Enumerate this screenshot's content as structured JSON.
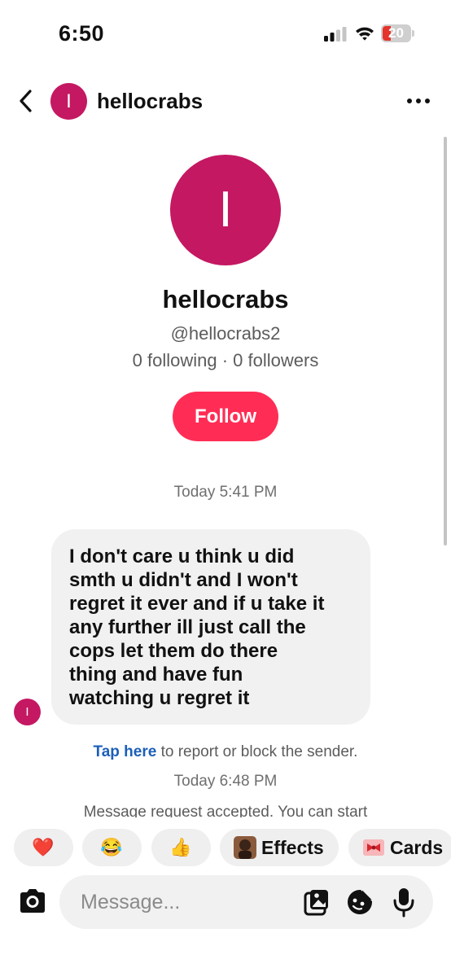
{
  "status_bar": {
    "time": "6:50",
    "battery": "20"
  },
  "header": {
    "avatar_initial": "I",
    "username": "hellocrabs"
  },
  "profile": {
    "avatar_initial": "I",
    "name": "hellocrabs",
    "handle": "@hellocrabs2",
    "stats": "0 following · 0 followers",
    "follow_label": "Follow"
  },
  "chat": {
    "timestamp_1": "Today 5:41 PM",
    "message_avatar_initial": "I",
    "message_lines": [
      "I don't care u think u did",
      "smth u didn't and I won't",
      "regret it ever and if u take it",
      "any further  ill just call the",
      "cops let them do there",
      "thing and have fun",
      "watching u regret it"
    ],
    "report_link": "Tap here",
    "report_text": " to report or block the sender.",
    "timestamp_2": "Today 6:48 PM",
    "system_message": "Message request accepted. You can start"
  },
  "reactions": [
    {
      "emoji": "❤️",
      "icon": "red-heart-icon"
    },
    {
      "emoji": "😂",
      "icon": "laughing-tears-icon"
    },
    {
      "emoji": "👍",
      "icon": "thumbs-up-icon"
    },
    {
      "label": "Effects",
      "icon": "effects-thumbnail-icon"
    },
    {
      "label": "Cards",
      "icon": "ribbon-card-icon"
    }
  ],
  "composer": {
    "placeholder": "Message..."
  },
  "colors": {
    "brand_avatar": "#c41862",
    "follow_button": "#ff2d55",
    "link": "#1c5fb8",
    "battery_low": "#e5342b"
  }
}
